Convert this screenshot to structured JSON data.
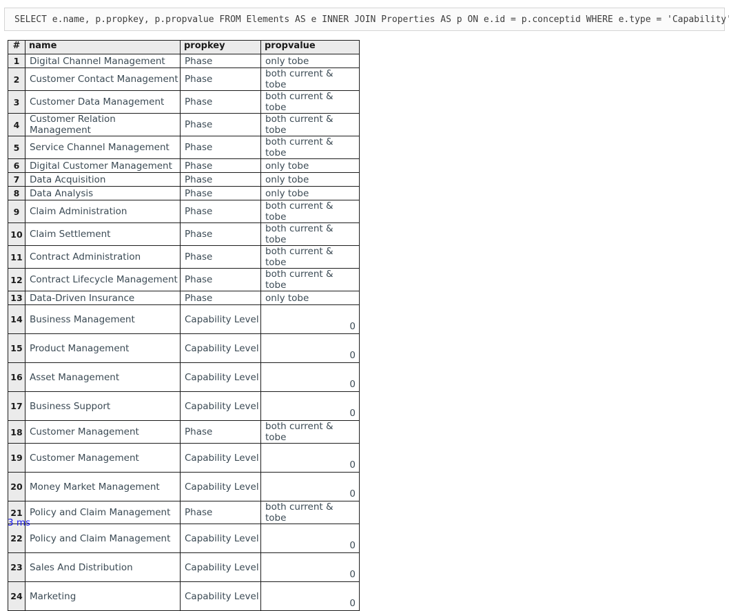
{
  "query": {
    "sql": "SELECT e.name, p.propkey, p.propvalue FROM Elements AS e INNER JOIN Properties AS p ON e.id = p.conceptid WHERE e.type = 'Capability'"
  },
  "results": {
    "columns": [
      "#",
      "name",
      "propkey",
      "propvalue"
    ],
    "rows": [
      {
        "idx": "1",
        "name": "Digital Channel Management",
        "propkey": "Phase",
        "propvalue": "only tobe",
        "numeric": false,
        "tall": false
      },
      {
        "idx": "2",
        "name": "Customer Contact Management",
        "propkey": "Phase",
        "propvalue": "both current & tobe",
        "numeric": false,
        "tall": false
      },
      {
        "idx": "3",
        "name": "Customer Data Management",
        "propkey": "Phase",
        "propvalue": "both current & tobe",
        "numeric": false,
        "tall": false
      },
      {
        "idx": "4",
        "name": "Customer Relation Management",
        "propkey": "Phase",
        "propvalue": "both current & tobe",
        "numeric": false,
        "tall": false
      },
      {
        "idx": "5",
        "name": "Service Channel Management",
        "propkey": "Phase",
        "propvalue": "both current & tobe",
        "numeric": false,
        "tall": false
      },
      {
        "idx": "6",
        "name": "Digital Customer Management",
        "propkey": "Phase",
        "propvalue": "only tobe",
        "numeric": false,
        "tall": false
      },
      {
        "idx": "7",
        "name": "Data Acquisition",
        "propkey": "Phase",
        "propvalue": "only tobe",
        "numeric": false,
        "tall": false
      },
      {
        "idx": "8",
        "name": "Data Analysis",
        "propkey": "Phase",
        "propvalue": "only tobe",
        "numeric": false,
        "tall": false
      },
      {
        "idx": "9",
        "name": "Claim Administration",
        "propkey": "Phase",
        "propvalue": "both current & tobe",
        "numeric": false,
        "tall": false
      },
      {
        "idx": "10",
        "name": "Claim Settlement",
        "propkey": "Phase",
        "propvalue": "both current & tobe",
        "numeric": false,
        "tall": false
      },
      {
        "idx": "11",
        "name": "Contract Administration",
        "propkey": "Phase",
        "propvalue": "both current & tobe",
        "numeric": false,
        "tall": false
      },
      {
        "idx": "12",
        "name": "Contract Lifecycle Management",
        "propkey": "Phase",
        "propvalue": "both current & tobe",
        "numeric": false,
        "tall": false
      },
      {
        "idx": "13",
        "name": "Data-Driven Insurance",
        "propkey": "Phase",
        "propvalue": "only tobe",
        "numeric": false,
        "tall": false
      },
      {
        "idx": "14",
        "name": "Business Management",
        "propkey": "Capability Level",
        "propvalue": "0",
        "numeric": true,
        "tall": true
      },
      {
        "idx": "15",
        "name": "Product Management",
        "propkey": "Capability Level",
        "propvalue": "0",
        "numeric": true,
        "tall": true
      },
      {
        "idx": "16",
        "name": "Asset Management",
        "propkey": "Capability Level",
        "propvalue": "0",
        "numeric": true,
        "tall": true
      },
      {
        "idx": "17",
        "name": "Business Support",
        "propkey": "Capability Level",
        "propvalue": "0",
        "numeric": true,
        "tall": true
      },
      {
        "idx": "18",
        "name": "Customer Management",
        "propkey": "Phase",
        "propvalue": "both current & tobe",
        "numeric": false,
        "tall": false
      },
      {
        "idx": "19",
        "name": "Customer Management",
        "propkey": "Capability Level",
        "propvalue": "0",
        "numeric": true,
        "tall": true
      },
      {
        "idx": "20",
        "name": "Money Market Management",
        "propkey": "Capability Level",
        "propvalue": "0",
        "numeric": true,
        "tall": true
      },
      {
        "idx": "21",
        "name": "Policy and Claim Management",
        "propkey": "Phase",
        "propvalue": "both current & tobe",
        "numeric": false,
        "tall": false
      },
      {
        "idx": "22",
        "name": "Policy and Claim Management",
        "propkey": "Capability Level",
        "propvalue": "0",
        "numeric": true,
        "tall": true
      },
      {
        "idx": "23",
        "name": "Sales And Distribution",
        "propkey": "Capability Level",
        "propvalue": "0",
        "numeric": true,
        "tall": true
      },
      {
        "idx": "24",
        "name": "Marketing",
        "propkey": "Capability Level",
        "propvalue": "0",
        "numeric": true,
        "tall": true
      }
    ]
  },
  "footer": {
    "timing": "3 ms"
  },
  "colors": {
    "header_bg": "#ebebeb",
    "index_bg": "#ebebeb",
    "border": "#1b1b1b",
    "text": "#3b4a54",
    "link": "#1a1aee",
    "sql_border": "#d4d4d4",
    "sql_bg": "#fbfbfb"
  }
}
